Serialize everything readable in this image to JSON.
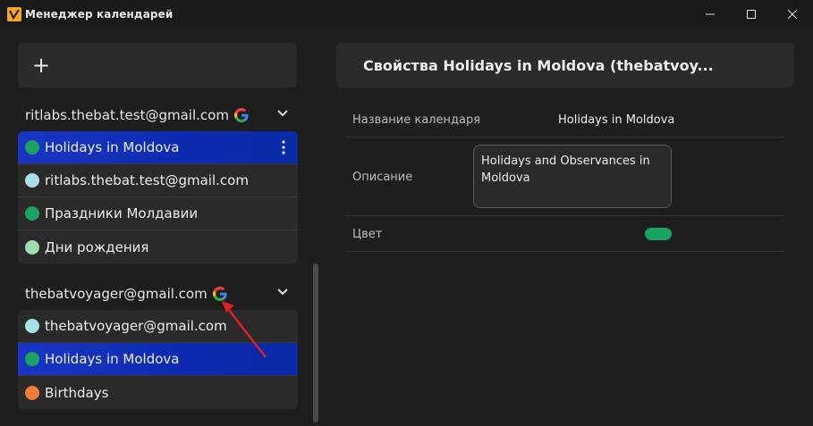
{
  "window": {
    "title": "Менеджер календарей"
  },
  "left": {
    "add_label": "+",
    "accounts": [
      {
        "label": "ritlabs.thebat.test@gmail.com",
        "calendars": [
          {
            "label": "Holidays in Moldova",
            "color": "#1aa260",
            "selected": true
          },
          {
            "label": "ritlabs.thebat.test@gmail.com",
            "color": "#a8e0e8",
            "selected": false
          },
          {
            "label": "Праздники Молдавии",
            "color": "#1aa260",
            "selected": false
          },
          {
            "label": "Дни рождения",
            "color": "#9fdcb0",
            "selected": false
          }
        ]
      },
      {
        "label": "thebatvoyager@gmail.com",
        "calendars": [
          {
            "label": "thebatvoyager@gmail.com",
            "color": "#a8e0e8",
            "selected": false
          },
          {
            "label": "Holidays in Moldova",
            "color": "#1aa260",
            "selected": true
          },
          {
            "label": "Birthdays",
            "color": "#f47a3a",
            "selected": false
          }
        ]
      }
    ]
  },
  "right": {
    "title": "Свойства Holidays in Moldova (thebatvoy...",
    "props": {
      "name_label": "Название календаря",
      "name_value": "Holidays in Moldova",
      "desc_label": "Описание",
      "desc_value": "Holidays and Observances in Moldova",
      "color_label": "Цвет",
      "color_value": "#1aa260"
    }
  },
  "colors": {
    "selected_bg": "#1a35c4",
    "annotation_arrow": "#e02020"
  }
}
